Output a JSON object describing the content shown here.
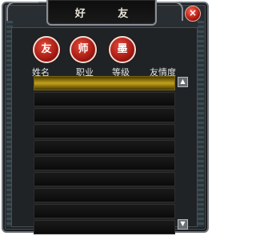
{
  "window": {
    "title": "好 友"
  },
  "close_button": {
    "label": "×"
  },
  "tabs": [
    {
      "label": "友"
    },
    {
      "label": "师"
    },
    {
      "label": "墨"
    }
  ],
  "columns": [
    "姓名",
    "职业",
    "等级",
    "友情度"
  ],
  "rows": [
    {
      "selected": true
    },
    {},
    {},
    {},
    {},
    {},
    {},
    {},
    {},
    {}
  ],
  "scroll": {
    "up": "▲",
    "down": "▼"
  }
}
